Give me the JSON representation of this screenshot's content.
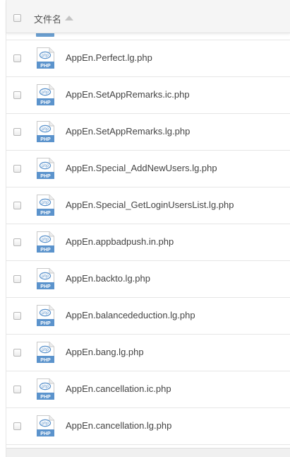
{
  "header": {
    "column_title": "文件名",
    "sort": "ascending"
  },
  "icon_label": "PHP",
  "icon_logo": "php",
  "colors": {
    "icon_blue": "#5b93cc",
    "text": "#444444",
    "border": "#e6e6e6"
  },
  "files": [
    {
      "name": "AppEn.Perfect.lg.php"
    },
    {
      "name": "AppEn.SetAppRemarks.ic.php"
    },
    {
      "name": "AppEn.SetAppRemarks.lg.php"
    },
    {
      "name": "AppEn.Special_AddNewUsers.lg.php"
    },
    {
      "name": "AppEn.Special_GetLoginUsersList.lg.php"
    },
    {
      "name": "AppEn.appbadpush.in.php"
    },
    {
      "name": "AppEn.backto.lg.php"
    },
    {
      "name": "AppEn.balancededuction.lg.php"
    },
    {
      "name": "AppEn.bang.lg.php"
    },
    {
      "name": "AppEn.cancellation.ic.php"
    },
    {
      "name": "AppEn.cancellation.lg.php"
    }
  ]
}
